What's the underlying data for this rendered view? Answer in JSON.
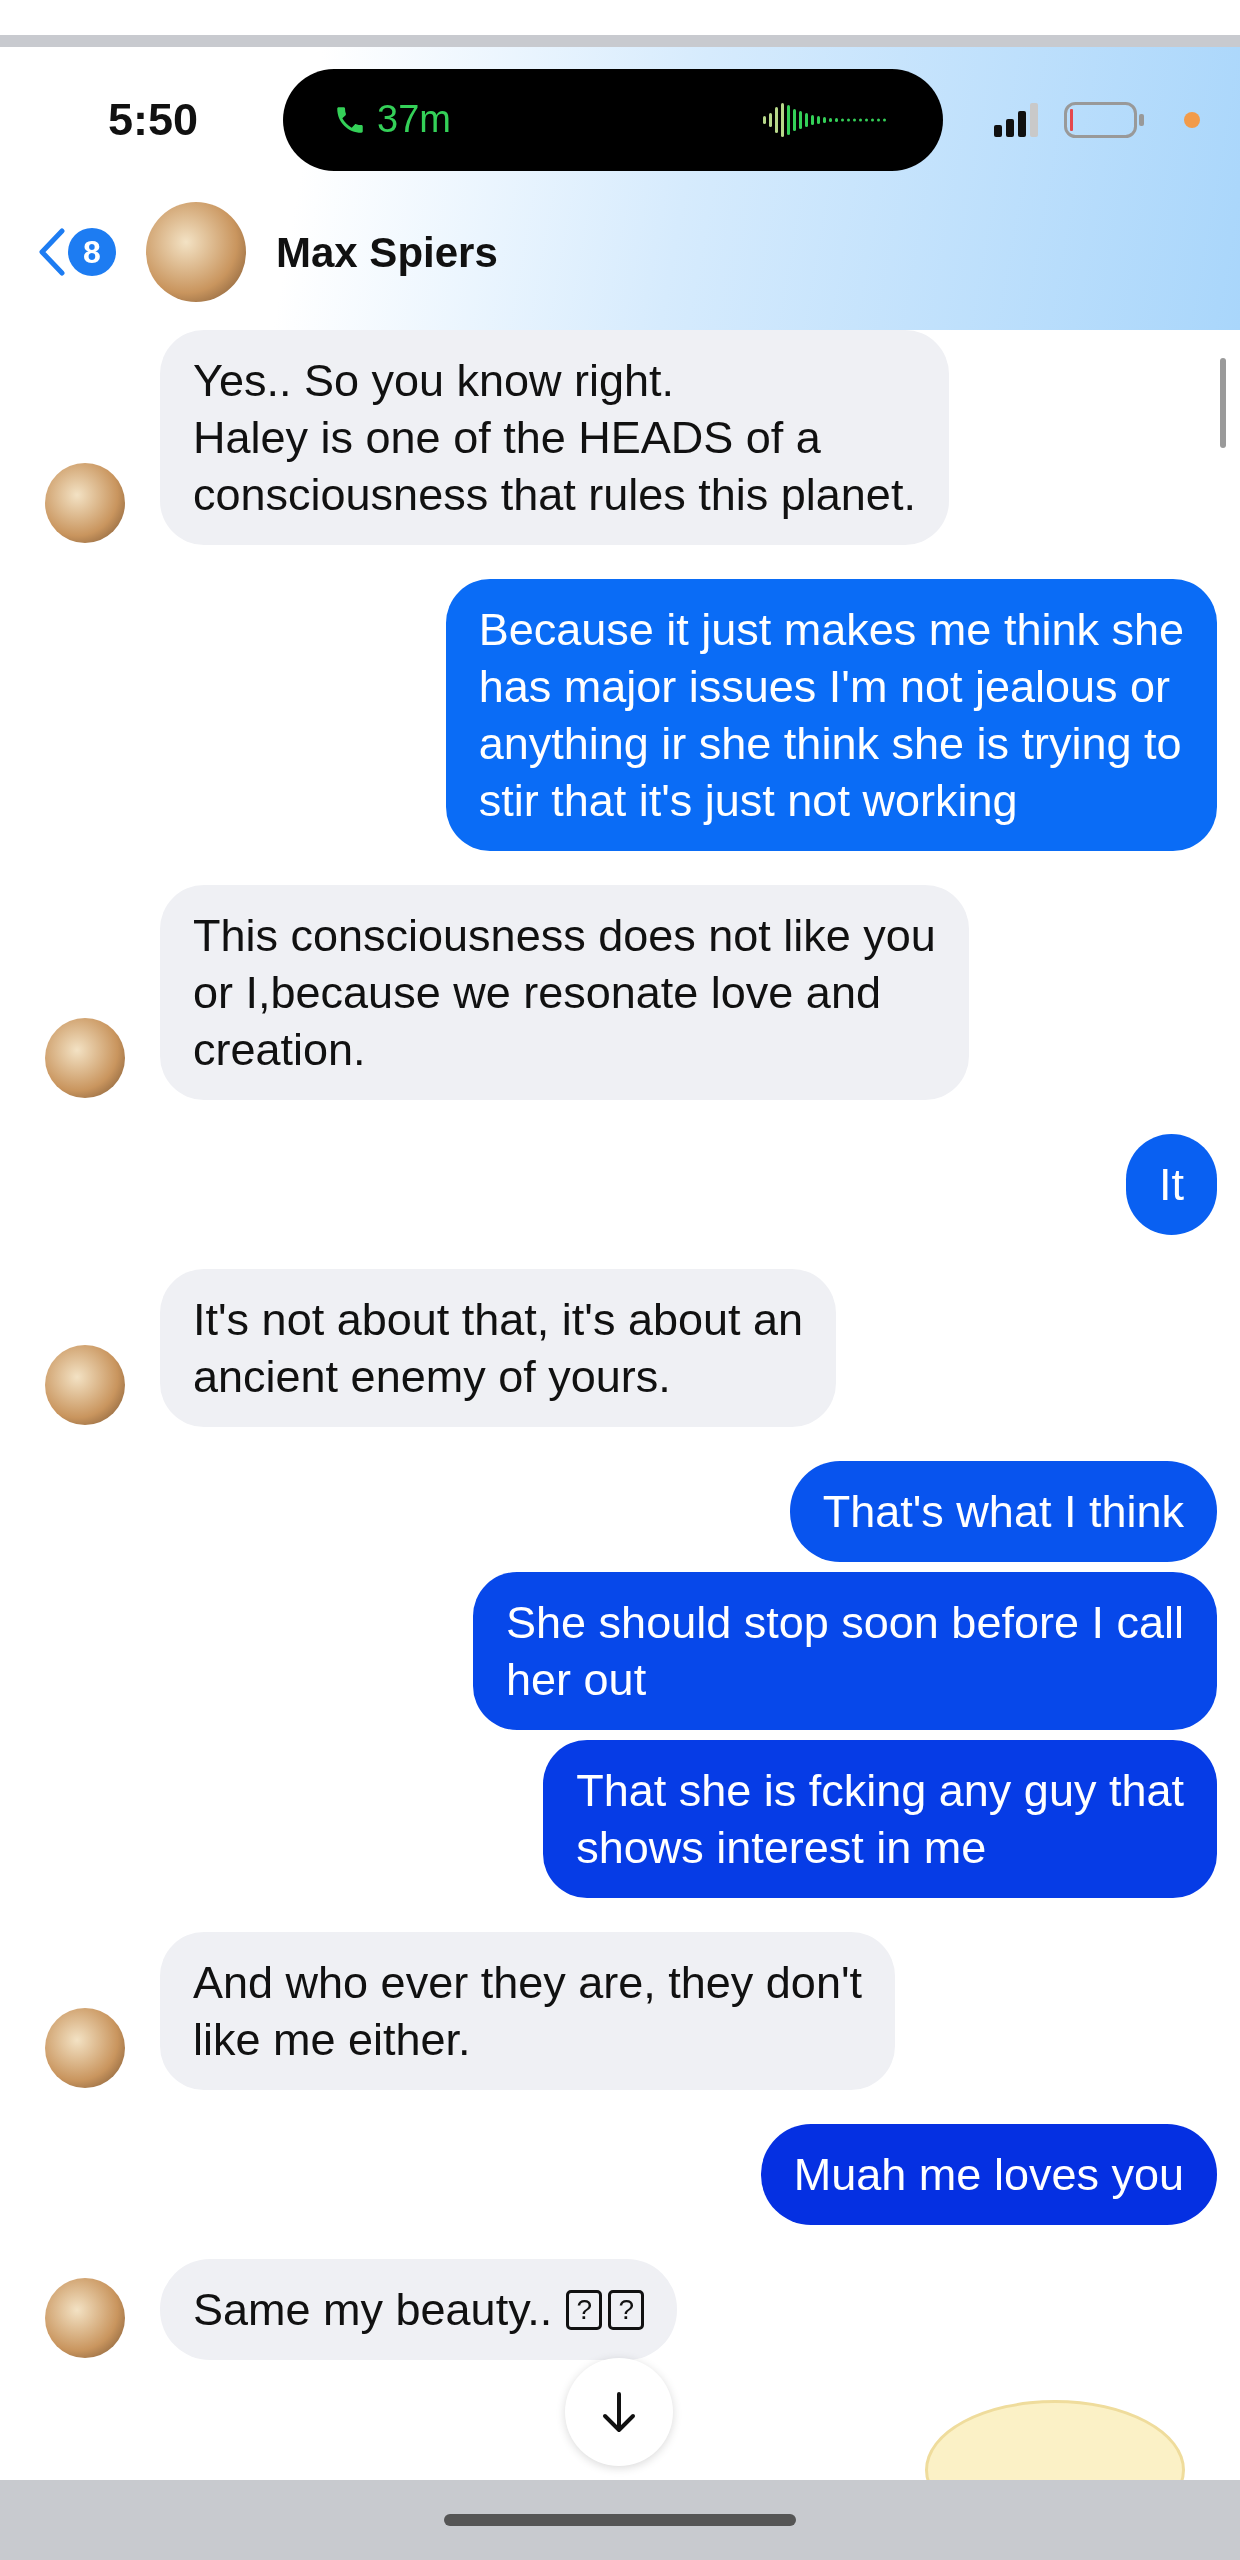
{
  "status_bar": {
    "time": "5:50",
    "call_duration": "37m"
  },
  "header": {
    "back_badge": "8",
    "contact_name": "Max Spiers"
  },
  "messages": [
    {
      "kind": "received",
      "lines": [
        "Yes.. So you know right.",
        "Haley is one of the HEADS of a",
        "consciousness that rules this planet."
      ]
    },
    {
      "kind": "sent",
      "lines": [
        "Because it just makes me think she",
        "has major issues I'm not jealous or",
        "anything ir she think she is trying to",
        "stir that it's just not working"
      ]
    },
    {
      "kind": "received",
      "lines": [
        "This consciousness does not like you",
        "or I,because we resonate love and",
        "creation."
      ]
    },
    {
      "kind": "sent",
      "lines": [
        "It"
      ]
    },
    {
      "kind": "received",
      "lines": [
        "It's not about that, it's about an",
        "ancient enemy of yours."
      ]
    },
    {
      "kind": "sent",
      "lines": [
        "That's what I think"
      ]
    },
    {
      "kind": "sent",
      "lines": [
        "She should stop soon before I call",
        "her out"
      ]
    },
    {
      "kind": "sent",
      "lines": [
        "That she is fcking any guy that",
        "shows interest in me"
      ]
    },
    {
      "kind": "received",
      "lines": [
        "And who ever they are, they don't",
        "like me either."
      ]
    },
    {
      "kind": "sent",
      "lines": [
        "Muah me loves you"
      ]
    },
    {
      "kind": "received",
      "lines": [
        "Same my beauty.."
      ],
      "glyphs": [
        "?",
        "?"
      ]
    }
  ]
}
